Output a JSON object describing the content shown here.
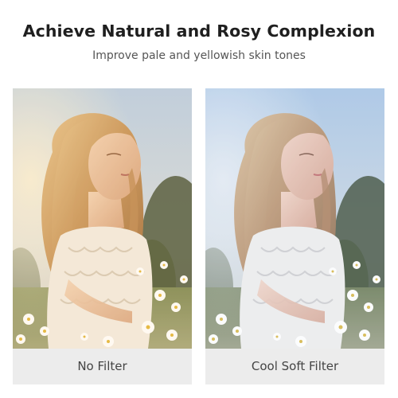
{
  "header": {
    "title": "Achieve Natural and Rosy Complexion",
    "subtitle": "Improve pale and yellowish skin tones"
  },
  "comparison": [
    {
      "label": "No Filter",
      "variant": "warm"
    },
    {
      "label": "Cool Soft Filter",
      "variant": "cool"
    }
  ],
  "colors": {
    "background": "#ffffff",
    "caption_bar": "#ececec",
    "title_text": "#1f1f1f",
    "subtitle_text": "#555555",
    "caption_text": "#444444"
  }
}
